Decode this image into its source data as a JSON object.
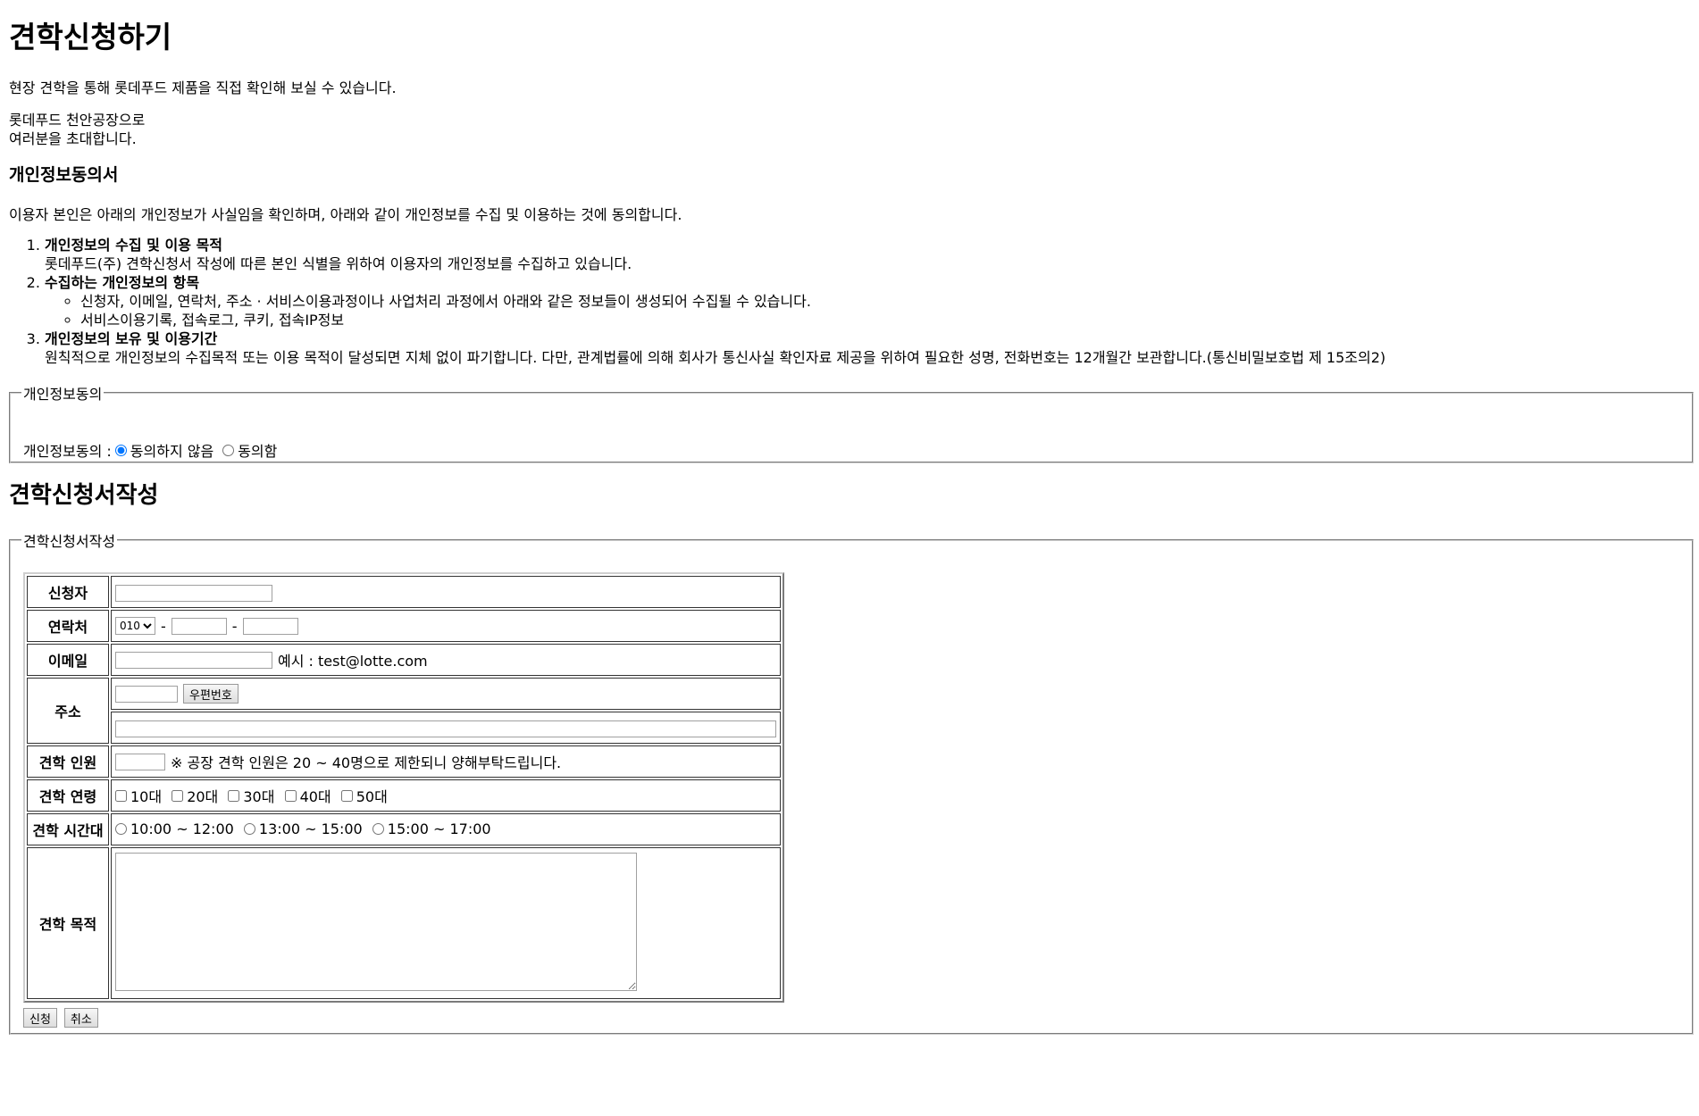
{
  "page": {
    "title": "견학신청하기",
    "intro": "현장 견학을 통해 롯데푸드 제품을 직접 확인해 보실 수 있습니다.",
    "invite_line1": "롯데푸드 천안공장으로",
    "invite_line2": "여러분을 초대합니다."
  },
  "privacy": {
    "heading": "개인정보동의서",
    "statement": "이용자 본인은 아래의 개인정보가 사실임을 확인하며, 아래와 같이 개인정보를 수집 및 이용하는 것에 동의합니다.",
    "items": [
      {
        "title": "개인정보의 수집 및 이용 목적",
        "text": "롯데푸드(주) 견학신청서 작성에 따른 본인 식별을 위하여 이용자의 개인정보를 수집하고 있습니다."
      },
      {
        "title": "수집하는 개인정보의 항목",
        "subitems": [
          "신청자, 이메일, 연락처, 주소 · 서비스이용과정이나 사업처리 과정에서 아래와 같은 정보들이 생성되어 수집될 수 있습니다.",
          "서비스이용기록, 접속로그, 쿠키, 접속IP정보"
        ]
      },
      {
        "title": "개인정보의 보유 및 이용기간",
        "text": "원칙적으로 개인정보의 수집목적 또는 이용 목적이 달성되면 지체 없이 파기합니다. 다만, 관계법률에 의해 회사가 통신사실 확인자료 제공을 위하여 필요한 성명, 전화번호는 12개월간 보관합니다.(통신비밀보호법 제 15조의2)"
      }
    ],
    "fieldset_legend": "개인정보동의",
    "consent_label": "개인정보동의 :",
    "option_disagree": "동의하지 않음",
    "option_agree": "동의함",
    "selected": "disagree"
  },
  "form": {
    "heading": "견학신청서작성",
    "legend": "견학신청서작성",
    "labels": {
      "applicant": "신청자",
      "contact": "연락처",
      "email": "이메일",
      "address": "주소",
      "visitors": "견학 인원",
      "age": "견학 연령",
      "time": "견학 시간대",
      "purpose": "견학 목적"
    },
    "phone_prefix": "010",
    "phone_sep": "-",
    "email_example": "예시 : test@lotte.com",
    "zip_button": "우편번호",
    "visitors_note": "※ 공장 견학 인원은 20 ~ 40명으로 제한되니 양해부탁드립니다.",
    "age_options": [
      "10대",
      "20대",
      "30대",
      "40대",
      "50대"
    ],
    "time_options": [
      "10:00 ~ 12:00",
      "13:00 ~ 15:00",
      "15:00 ~ 17:00"
    ],
    "submit_button": "신청",
    "cancel_button": "취소"
  }
}
